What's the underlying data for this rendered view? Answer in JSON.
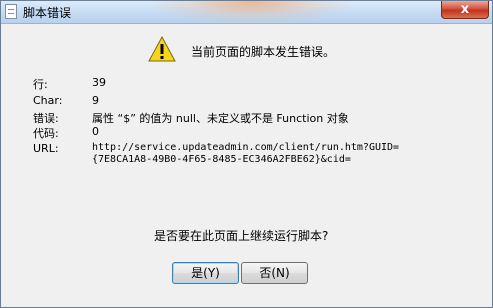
{
  "window": {
    "title": "脚本错误",
    "close_symbol": "x"
  },
  "header": {
    "icon": "warning-icon",
    "message": "当前页面的脚本发生错误。"
  },
  "details": [
    {
      "label": "行:",
      "value": "39"
    },
    {
      "label": "Char:",
      "value": "9"
    },
    {
      "label": "错误:",
      "value": "属性 “$” 的值为 null、未定义或不是 Function 对象"
    },
    {
      "label": "代码:",
      "value": "0"
    },
    {
      "label": "URL:",
      "value_line1": "http://service.updateadmin.com/client/run.htm?GUID=",
      "value_line2": "{7E8CA1A8-49B0-4F65-8485-EC346A2FBE62}&cid="
    }
  ],
  "question": "是否要在此页面上继续运行脚本?",
  "buttons": {
    "yes": "是(Y)",
    "no": "否(N)"
  }
}
